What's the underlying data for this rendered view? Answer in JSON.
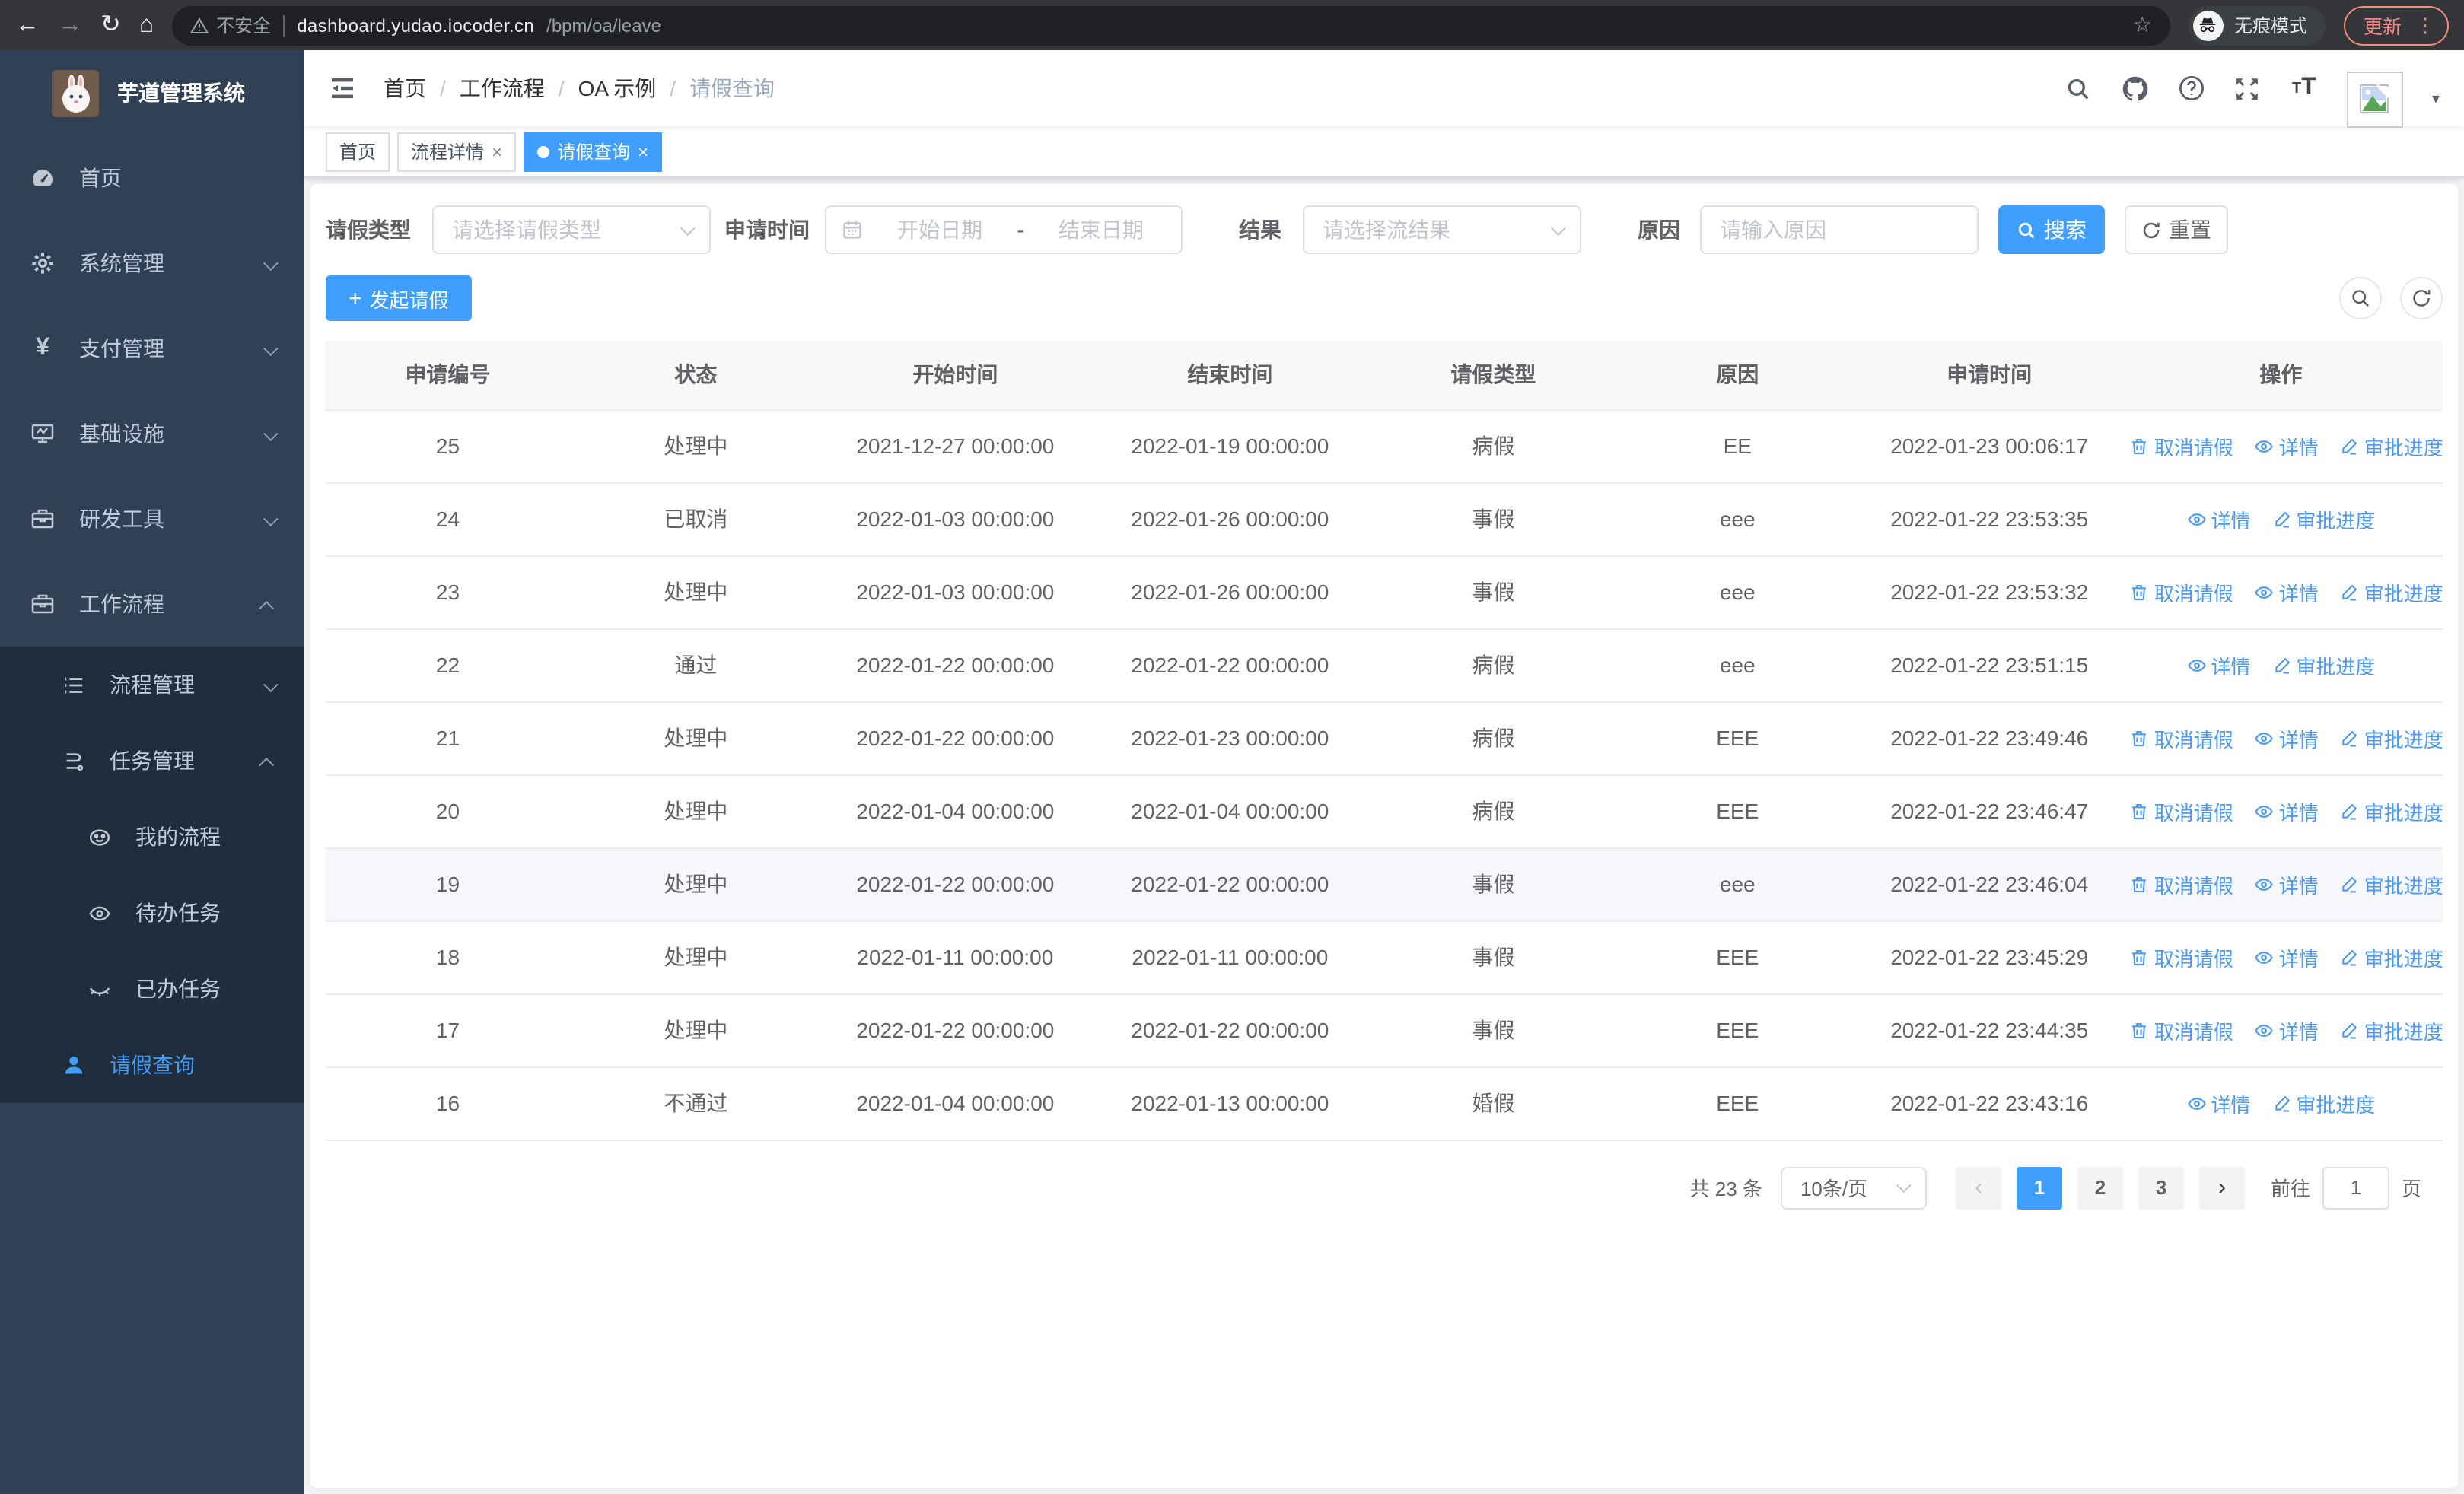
{
  "browser": {
    "security_label": "不安全",
    "url_host": "dashboard.yudao.iocoder.cn",
    "url_path": "/bpm/oa/leave",
    "incognito_label": "无痕模式",
    "update_label": "更新"
  },
  "sidebar": {
    "title": "芋道管理系统",
    "items": [
      {
        "label": "首页",
        "icon": "dashboard-icon"
      },
      {
        "label": "系统管理",
        "icon": "gear-icon",
        "chevron": "down"
      },
      {
        "label": "支付管理",
        "icon": "yen-icon",
        "chevron": "down"
      },
      {
        "label": "基础设施",
        "icon": "monitor-icon",
        "chevron": "down"
      },
      {
        "label": "研发工具",
        "icon": "toolbox-icon",
        "chevron": "down"
      },
      {
        "label": "工作流程",
        "icon": "toolbox-icon",
        "chevron": "up"
      },
      {
        "label": "流程管理",
        "icon": "list-icon",
        "chevron": "down"
      },
      {
        "label": "任务管理",
        "icon": "branch-icon",
        "chevron": "up"
      },
      {
        "label": "我的流程",
        "icon": "robot-icon"
      },
      {
        "label": "待办任务",
        "icon": "eye-icon"
      },
      {
        "label": "已办任务",
        "icon": "eye-closed-icon"
      },
      {
        "label": "请假查询",
        "icon": "user-icon",
        "active": true
      }
    ]
  },
  "header": {
    "breadcrumb": [
      "首页",
      "工作流程",
      "OA 示例",
      "请假查询"
    ],
    "icons": [
      "search-icon",
      "github-icon",
      "help-icon",
      "fullscreen-icon",
      "font-size-icon",
      "avatar",
      "caret-down-icon"
    ]
  },
  "tabs": [
    {
      "label": "首页",
      "closable": false,
      "active": false
    },
    {
      "label": "流程详情",
      "closable": true,
      "active": false
    },
    {
      "label": "请假查询",
      "closable": true,
      "active": true
    }
  ],
  "filters": {
    "leave_type": {
      "label": "请假类型",
      "placeholder": "请选择请假类型"
    },
    "apply_time": {
      "label": "申请时间",
      "start_placeholder": "开始日期",
      "separator": "-",
      "end_placeholder": "结束日期"
    },
    "result": {
      "label": "结果",
      "placeholder": "请选择流结果"
    },
    "reason": {
      "label": "原因",
      "placeholder": "请输入原因"
    },
    "search_label": "搜索",
    "reset_label": "重置"
  },
  "toolbar": {
    "create_label": "发起请假"
  },
  "table": {
    "columns": [
      "申请编号",
      "状态",
      "开始时间",
      "结束时间",
      "请假类型",
      "原因",
      "申请时间",
      "操作"
    ],
    "action_labels": {
      "cancel": "取消请假",
      "detail": "详情",
      "progress": "审批进度"
    },
    "rows": [
      {
        "id": "25",
        "status": "处理中",
        "start": "2021-12-27 00:00:00",
        "end": "2022-01-19 00:00:00",
        "type": "病假",
        "reason": "EE",
        "apply_time": "2022-01-23 00:06:17",
        "actions": [
          "cancel",
          "detail",
          "progress"
        ],
        "hovered": false
      },
      {
        "id": "24",
        "status": "已取消",
        "start": "2022-01-03 00:00:00",
        "end": "2022-01-26 00:00:00",
        "type": "事假",
        "reason": "eee",
        "apply_time": "2022-01-22 23:53:35",
        "actions": [
          "detail",
          "progress"
        ],
        "hovered": false
      },
      {
        "id": "23",
        "status": "处理中",
        "start": "2022-01-03 00:00:00",
        "end": "2022-01-26 00:00:00",
        "type": "事假",
        "reason": "eee",
        "apply_time": "2022-01-22 23:53:32",
        "actions": [
          "cancel",
          "detail",
          "progress"
        ],
        "hovered": false
      },
      {
        "id": "22",
        "status": "通过",
        "start": "2022-01-22 00:00:00",
        "end": "2022-01-22 00:00:00",
        "type": "病假",
        "reason": "eee",
        "apply_time": "2022-01-22 23:51:15",
        "actions": [
          "detail",
          "progress"
        ],
        "hovered": false
      },
      {
        "id": "21",
        "status": "处理中",
        "start": "2022-01-22 00:00:00",
        "end": "2022-01-23 00:00:00",
        "type": "病假",
        "reason": "EEE",
        "apply_time": "2022-01-22 23:49:46",
        "actions": [
          "cancel",
          "detail",
          "progress"
        ],
        "hovered": false
      },
      {
        "id": "20",
        "status": "处理中",
        "start": "2022-01-04 00:00:00",
        "end": "2022-01-04 00:00:00",
        "type": "病假",
        "reason": "EEE",
        "apply_time": "2022-01-22 23:46:47",
        "actions": [
          "cancel",
          "detail",
          "progress"
        ],
        "hovered": false
      },
      {
        "id": "19",
        "status": "处理中",
        "start": "2022-01-22 00:00:00",
        "end": "2022-01-22 00:00:00",
        "type": "事假",
        "reason": "eee",
        "apply_time": "2022-01-22 23:46:04",
        "actions": [
          "cancel",
          "detail",
          "progress"
        ],
        "hovered": true
      },
      {
        "id": "18",
        "status": "处理中",
        "start": "2022-01-11 00:00:00",
        "end": "2022-01-11 00:00:00",
        "type": "事假",
        "reason": "EEE",
        "apply_time": "2022-01-22 23:45:29",
        "actions": [
          "cancel",
          "detail",
          "progress"
        ],
        "hovered": false
      },
      {
        "id": "17",
        "status": "处理中",
        "start": "2022-01-22 00:00:00",
        "end": "2022-01-22 00:00:00",
        "type": "事假",
        "reason": "EEE",
        "apply_time": "2022-01-22 23:44:35",
        "actions": [
          "cancel",
          "detail",
          "progress"
        ],
        "hovered": false
      },
      {
        "id": "16",
        "status": "不通过",
        "start": "2022-01-04 00:00:00",
        "end": "2022-01-13 00:00:00",
        "type": "婚假",
        "reason": "EEE",
        "apply_time": "2022-01-22 23:43:16",
        "actions": [
          "detail",
          "progress"
        ],
        "hovered": false
      }
    ]
  },
  "pagination": {
    "total_label": "共 23 条",
    "page_size": "10条/页",
    "pages": [
      "1",
      "2",
      "3"
    ],
    "active_page": "1",
    "goto_label": "前往",
    "goto_value": "1",
    "page_suffix": "页"
  },
  "colors": {
    "accent": "#409eff",
    "sidebar_bg": "#304156",
    "submenu_bg": "#1f2d3d",
    "update_pill": "#f28b82"
  }
}
